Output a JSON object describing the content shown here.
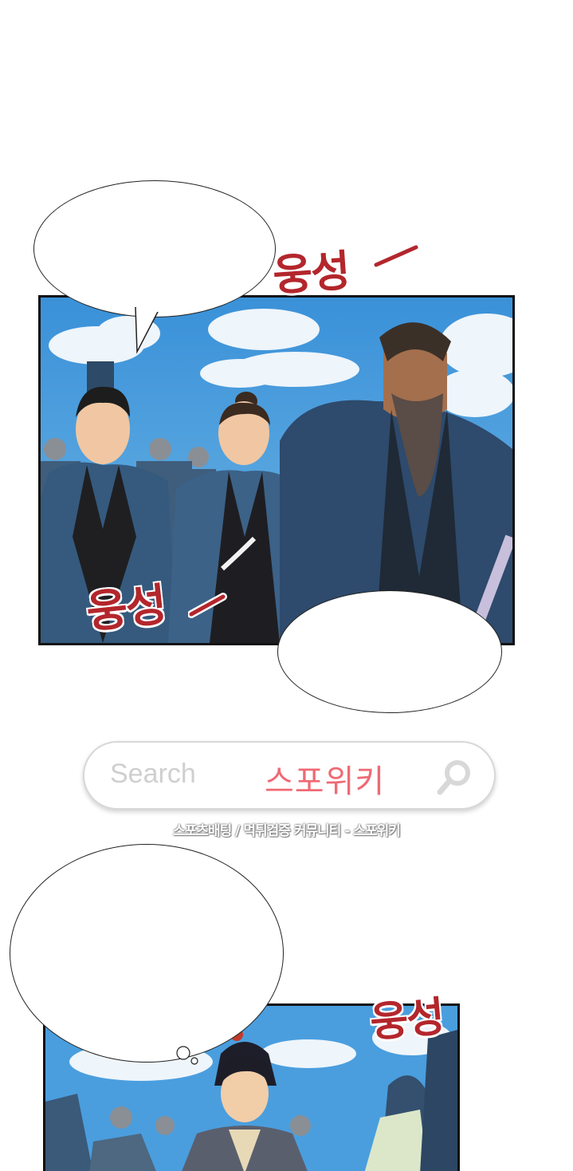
{
  "sfx": {
    "top": "웅성",
    "middle": "웅성",
    "bottom": "웅성"
  },
  "search_widget": {
    "placeholder": "Search",
    "brand": "스포위키",
    "icon": "search-icon",
    "caption": "스포츠배팅 / 먹튀검증 커뮤니티 - 스포위키"
  },
  "colors": {
    "sfx": "#b3262c",
    "brand": "#ef6a74",
    "sky": "#3f98da",
    "robe": "#2f4d6b"
  }
}
